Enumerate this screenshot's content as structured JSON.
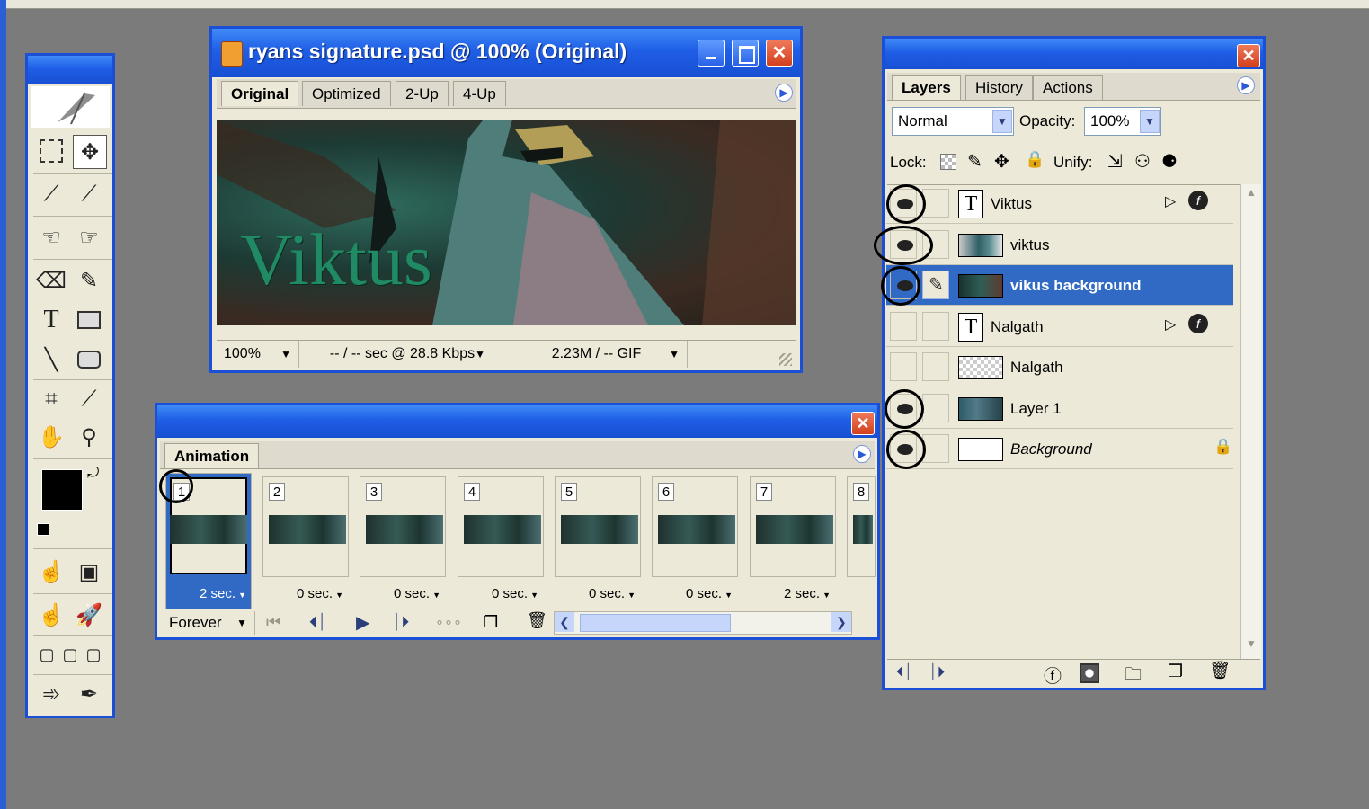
{
  "doc_window": {
    "title": "ryans signature.psd @ 100% (Original)",
    "tabs": [
      "Original",
      "Optimized",
      "2-Up",
      "4-Up"
    ],
    "active_tab": "Original",
    "canvas_text": "Viktus",
    "status": {
      "zoom": "100%",
      "speed": "-- / -- sec @ 28.8 Kbps",
      "size": "2.23M / -- GIF"
    }
  },
  "layers_panel": {
    "tabs": [
      "Layers",
      "History",
      "Actions"
    ],
    "blend_mode": "Normal",
    "opacity_label": "Opacity:",
    "opacity": "100%",
    "lock_label": "Lock:",
    "unify_label": "Unify:",
    "layers": [
      {
        "name": "Viktus",
        "type": "text",
        "visible": true,
        "selected": false
      },
      {
        "name": "viktus",
        "type": "image",
        "visible": true,
        "selected": false
      },
      {
        "name": "vikus background",
        "type": "image",
        "visible": true,
        "selected": true
      },
      {
        "name": "Nalgath",
        "type": "text",
        "visible": false,
        "selected": false
      },
      {
        "name": "Nalgath",
        "type": "image",
        "visible": false,
        "selected": false
      },
      {
        "name": "Layer 1",
        "type": "image",
        "visible": true,
        "selected": false
      },
      {
        "name": "Background",
        "type": "background",
        "visible": true,
        "selected": false
      }
    ]
  },
  "animation_panel": {
    "tab": "Animation",
    "frames": [
      {
        "num": "1",
        "delay": "2 sec."
      },
      {
        "num": "2",
        "delay": "0 sec."
      },
      {
        "num": "3",
        "delay": "0 sec."
      },
      {
        "num": "4",
        "delay": "0 sec."
      },
      {
        "num": "5",
        "delay": "0 sec."
      },
      {
        "num": "6",
        "delay": "0 sec."
      },
      {
        "num": "7",
        "delay": "2 sec."
      },
      {
        "num": "8",
        "delay": ""
      }
    ],
    "loop": "Forever"
  },
  "colors": {
    "titlebar": "#1f5ee6",
    "selection": "#316ac5",
    "canvas_text": "#1f8a63"
  }
}
